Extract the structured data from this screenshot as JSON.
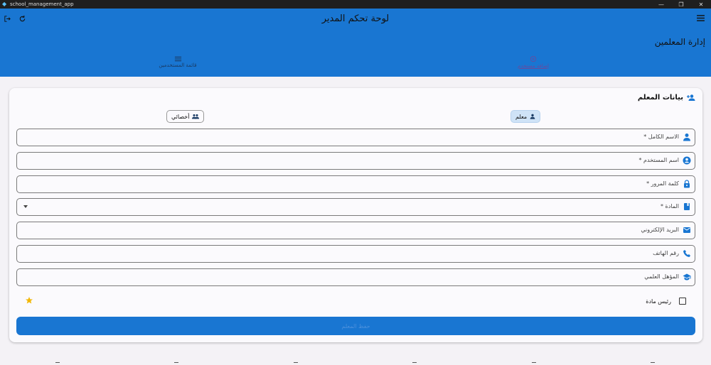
{
  "window": {
    "title": "school_management_app"
  },
  "appbar": {
    "title": "لوحة تحكم المدير",
    "section_title": "إدارة المعلمين"
  },
  "tabs": [
    {
      "label": "قائمة المستخدمين",
      "icon": "list-icon"
    },
    {
      "label": "إضافة مستخدم",
      "icon": "add-user-icon"
    }
  ],
  "form": {
    "header": "بيانات المعلم",
    "roles": {
      "teacher": "معلم",
      "specialist": "أخصائي"
    },
    "fields": {
      "full_name": "الاسم الكامل *",
      "username": "اسم المستخدم *",
      "password": "كلمة المرور *",
      "subject": "المادة *",
      "email": "البريد الإلكتروني",
      "phone": "رقم الهاتف",
      "qualification": "المؤهل العلمي"
    },
    "head_of_subject": "رئيس مادة",
    "save_label": "حفظ المعلم"
  },
  "colors": {
    "primary": "#1976d2",
    "chip_selected": "#cfe3f7",
    "star": "#f2b705"
  }
}
